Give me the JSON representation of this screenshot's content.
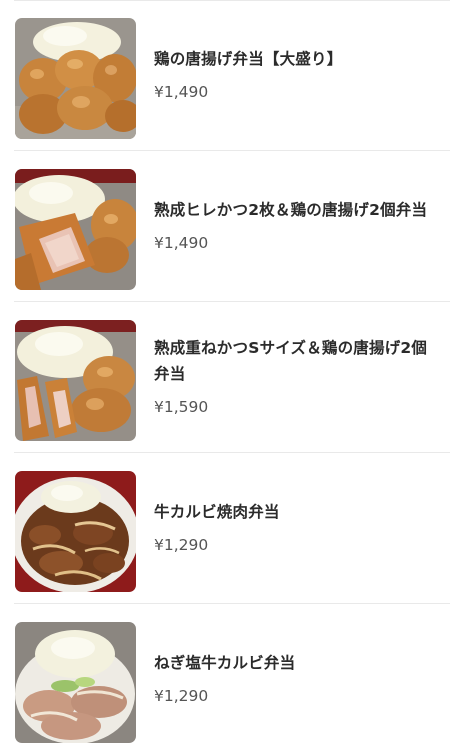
{
  "menu": {
    "items": [
      {
        "name": "鶏の唐揚げ弁当【大盛り】",
        "price": "¥1,490",
        "photo": "karaage-bento-photo"
      },
      {
        "name": "熟成ヒレかつ2枚＆鶏の唐揚げ2個弁当",
        "price": "¥1,490",
        "photo": "hirekatsu-karaage-bento-photo"
      },
      {
        "name": "熟成重ねかつSサイズ＆鶏の唐揚げ2個弁当",
        "price": "¥1,590",
        "photo": "kasanekatsu-karaage-bento-photo"
      },
      {
        "name": "牛カルビ焼肉弁当",
        "price": "¥1,290",
        "photo": "gyu-karubi-yakiniku-bento-photo"
      },
      {
        "name": "ねぎ塩牛カルビ弁当",
        "price": "¥1,290",
        "photo": "negishio-gyu-karubi-bento-photo"
      }
    ]
  }
}
